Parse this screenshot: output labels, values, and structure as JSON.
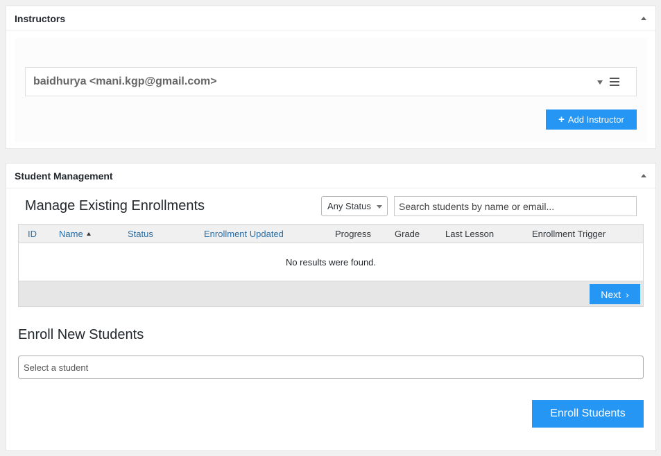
{
  "instructors": {
    "title": "Instructors",
    "entry": "baidhurya <mani.kgp@gmail.com>",
    "add_button": "Add Instructor"
  },
  "students": {
    "title": "Student Management",
    "manage_heading": "Manage Existing Enrollments",
    "status_filter": "Any Status",
    "search_placeholder": "Search students by name or email...",
    "columns": {
      "id": "ID",
      "name": "Name",
      "status": "Status",
      "enrollment_updated": "Enrollment Updated",
      "progress": "Progress",
      "grade": "Grade",
      "last_lesson": "Last Lesson",
      "enrollment_trigger": "Enrollment Trigger"
    },
    "empty_message": "No results were found.",
    "next_label": "Next",
    "enroll_heading": "Enroll New Students",
    "select_placeholder": "Select a student",
    "enroll_button": "Enroll Students"
  },
  "colors": {
    "accent": "#2596f3",
    "link": "#2a6ea6"
  }
}
